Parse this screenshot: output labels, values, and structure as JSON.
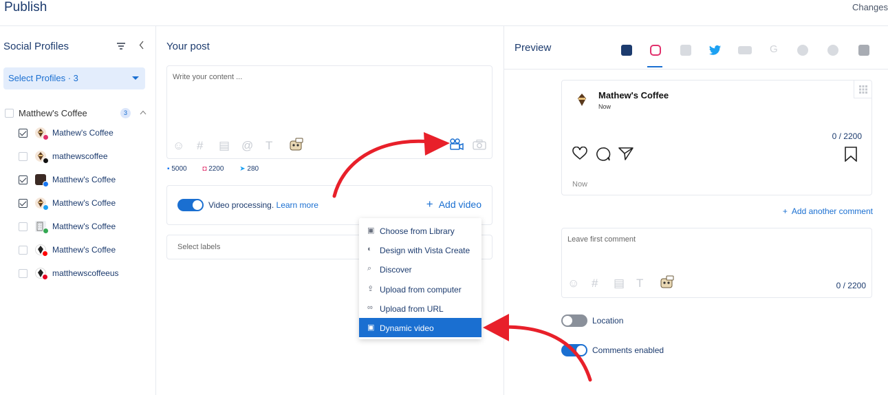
{
  "header": {
    "title": "Publish",
    "changes": "Changes"
  },
  "sidebar": {
    "title": "Social Profiles",
    "select_label": "Select Profiles · 3",
    "group": {
      "name": "Matthew's Coffee",
      "count": "3"
    },
    "profiles": [
      {
        "name": "Mathew's Coffee",
        "checked": true
      },
      {
        "name": "mathewscoffee",
        "checked": false
      },
      {
        "name": "Matthew's Coffee",
        "checked": true
      },
      {
        "name": "Matthew's Coffee",
        "checked": true
      },
      {
        "name": "Matthew's Coffee",
        "checked": false
      },
      {
        "name": "Matthew's Coffee",
        "checked": false
      },
      {
        "name": "matthewscoffeeus",
        "checked": false
      }
    ]
  },
  "post": {
    "title": "Your post",
    "placeholder": "Write your content ...",
    "limits": {
      "facebook": "5000",
      "instagram": "2200",
      "twitter": "280"
    },
    "video_processing": "Video processing.",
    "learn_more": "Learn more",
    "add_video": "Add video",
    "labels_placeholder": "Select labels",
    "menu": [
      {
        "label": "Choose from Library",
        "icon": "image-icon"
      },
      {
        "label": "Design with Vista Create",
        "icon": "vista-icon"
      },
      {
        "label": "Discover",
        "icon": "search-icon"
      },
      {
        "label": "Upload from computer",
        "icon": "upload-icon"
      },
      {
        "label": "Upload from URL",
        "icon": "link-icon"
      },
      {
        "label": "Dynamic video",
        "icon": "dynamic-video-icon"
      }
    ]
  },
  "preview": {
    "title": "Preview",
    "account": "Mathew's Coffee",
    "time": "Now",
    "counter": "0 / 2200",
    "footer_time": "Now",
    "add_comment": "Add another comment",
    "first_comment_placeholder": "Leave first comment",
    "first_comment_counter": "0 / 2200",
    "location_label": "Location",
    "location_on": false,
    "comments_label": "Comments enabled",
    "comments_on": true
  },
  "colors": {
    "accent": "#1a6fd1",
    "arrow": "#e8202a",
    "facebook": "#1877f2",
    "instagram": "#e1306c",
    "twitter": "#1da1f2"
  }
}
